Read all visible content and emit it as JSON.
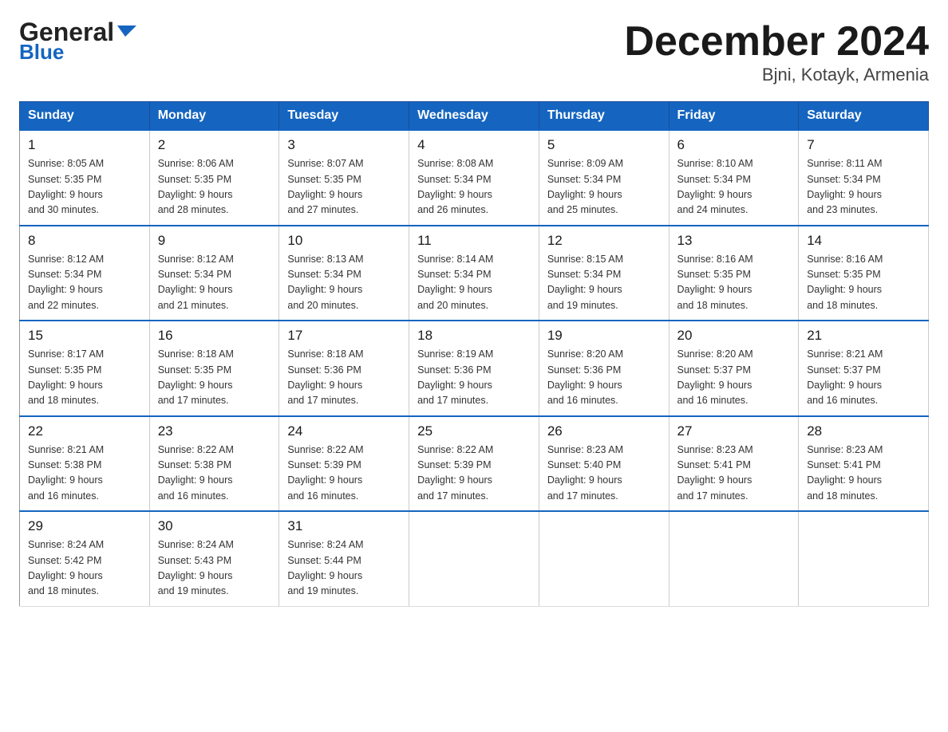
{
  "header": {
    "logo_line1": "General",
    "logo_arrow": "▶",
    "logo_line2": "Blue",
    "month_title": "December 2024",
    "location": "Bjni, Kotayk, Armenia"
  },
  "weekdays": [
    "Sunday",
    "Monday",
    "Tuesday",
    "Wednesday",
    "Thursday",
    "Friday",
    "Saturday"
  ],
  "weeks": [
    [
      {
        "day": "1",
        "sunrise": "8:05 AM",
        "sunset": "5:35 PM",
        "daylight": "9 hours and 30 minutes."
      },
      {
        "day": "2",
        "sunrise": "8:06 AM",
        "sunset": "5:35 PM",
        "daylight": "9 hours and 28 minutes."
      },
      {
        "day": "3",
        "sunrise": "8:07 AM",
        "sunset": "5:35 PM",
        "daylight": "9 hours and 27 minutes."
      },
      {
        "day": "4",
        "sunrise": "8:08 AM",
        "sunset": "5:34 PM",
        "daylight": "9 hours and 26 minutes."
      },
      {
        "day": "5",
        "sunrise": "8:09 AM",
        "sunset": "5:34 PM",
        "daylight": "9 hours and 25 minutes."
      },
      {
        "day": "6",
        "sunrise": "8:10 AM",
        "sunset": "5:34 PM",
        "daylight": "9 hours and 24 minutes."
      },
      {
        "day": "7",
        "sunrise": "8:11 AM",
        "sunset": "5:34 PM",
        "daylight": "9 hours and 23 minutes."
      }
    ],
    [
      {
        "day": "8",
        "sunrise": "8:12 AM",
        "sunset": "5:34 PM",
        "daylight": "9 hours and 22 minutes."
      },
      {
        "day": "9",
        "sunrise": "8:12 AM",
        "sunset": "5:34 PM",
        "daylight": "9 hours and 21 minutes."
      },
      {
        "day": "10",
        "sunrise": "8:13 AM",
        "sunset": "5:34 PM",
        "daylight": "9 hours and 20 minutes."
      },
      {
        "day": "11",
        "sunrise": "8:14 AM",
        "sunset": "5:34 PM",
        "daylight": "9 hours and 20 minutes."
      },
      {
        "day": "12",
        "sunrise": "8:15 AM",
        "sunset": "5:34 PM",
        "daylight": "9 hours and 19 minutes."
      },
      {
        "day": "13",
        "sunrise": "8:16 AM",
        "sunset": "5:35 PM",
        "daylight": "9 hours and 18 minutes."
      },
      {
        "day": "14",
        "sunrise": "8:16 AM",
        "sunset": "5:35 PM",
        "daylight": "9 hours and 18 minutes."
      }
    ],
    [
      {
        "day": "15",
        "sunrise": "8:17 AM",
        "sunset": "5:35 PM",
        "daylight": "9 hours and 18 minutes."
      },
      {
        "day": "16",
        "sunrise": "8:18 AM",
        "sunset": "5:35 PM",
        "daylight": "9 hours and 17 minutes."
      },
      {
        "day": "17",
        "sunrise": "8:18 AM",
        "sunset": "5:36 PM",
        "daylight": "9 hours and 17 minutes."
      },
      {
        "day": "18",
        "sunrise": "8:19 AM",
        "sunset": "5:36 PM",
        "daylight": "9 hours and 17 minutes."
      },
      {
        "day": "19",
        "sunrise": "8:20 AM",
        "sunset": "5:36 PM",
        "daylight": "9 hours and 16 minutes."
      },
      {
        "day": "20",
        "sunrise": "8:20 AM",
        "sunset": "5:37 PM",
        "daylight": "9 hours and 16 minutes."
      },
      {
        "day": "21",
        "sunrise": "8:21 AM",
        "sunset": "5:37 PM",
        "daylight": "9 hours and 16 minutes."
      }
    ],
    [
      {
        "day": "22",
        "sunrise": "8:21 AM",
        "sunset": "5:38 PM",
        "daylight": "9 hours and 16 minutes."
      },
      {
        "day": "23",
        "sunrise": "8:22 AM",
        "sunset": "5:38 PM",
        "daylight": "9 hours and 16 minutes."
      },
      {
        "day": "24",
        "sunrise": "8:22 AM",
        "sunset": "5:39 PM",
        "daylight": "9 hours and 16 minutes."
      },
      {
        "day": "25",
        "sunrise": "8:22 AM",
        "sunset": "5:39 PM",
        "daylight": "9 hours and 17 minutes."
      },
      {
        "day": "26",
        "sunrise": "8:23 AM",
        "sunset": "5:40 PM",
        "daylight": "9 hours and 17 minutes."
      },
      {
        "day": "27",
        "sunrise": "8:23 AM",
        "sunset": "5:41 PM",
        "daylight": "9 hours and 17 minutes."
      },
      {
        "day": "28",
        "sunrise": "8:23 AM",
        "sunset": "5:41 PM",
        "daylight": "9 hours and 18 minutes."
      }
    ],
    [
      {
        "day": "29",
        "sunrise": "8:24 AM",
        "sunset": "5:42 PM",
        "daylight": "9 hours and 18 minutes."
      },
      {
        "day": "30",
        "sunrise": "8:24 AM",
        "sunset": "5:43 PM",
        "daylight": "9 hours and 19 minutes."
      },
      {
        "day": "31",
        "sunrise": "8:24 AM",
        "sunset": "5:44 PM",
        "daylight": "9 hours and 19 minutes."
      },
      null,
      null,
      null,
      null
    ]
  ],
  "labels": {
    "sunrise_prefix": "Sunrise: ",
    "sunset_prefix": "Sunset: ",
    "daylight_prefix": "Daylight: "
  }
}
